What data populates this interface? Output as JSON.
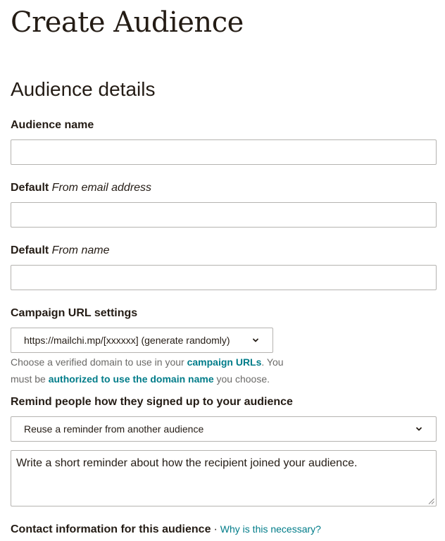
{
  "page": {
    "title": "Create Audience"
  },
  "section": {
    "title": "Audience details"
  },
  "fields": {
    "audience_name": {
      "label": "Audience name",
      "value": ""
    },
    "from_email": {
      "label_prefix": "Default ",
      "label_italic": "From email address",
      "value": ""
    },
    "from_name": {
      "label_prefix": "Default ",
      "label_italic": "From name",
      "value": ""
    }
  },
  "campaign_url": {
    "label": "Campaign URL settings",
    "selected": "https://mailchi.mp/[xxxxxx] (generate randomly)",
    "help_prefix": "Choose a verified domain to use in your ",
    "help_link1": "campaign URLs",
    "help_middle": ". You must be ",
    "help_link2": "authorized to use the domain name",
    "help_suffix": " you choose."
  },
  "reminder": {
    "label": "Remind people how they signed up to your audience",
    "select_value": "Reuse a reminder from another audience",
    "textarea_value": "Write a short reminder about how the recipient joined your audience."
  },
  "contact": {
    "label": "Contact information for this audience",
    "separator": "·",
    "link": "Why is this necessary?"
  },
  "colors": {
    "text": "#241c15",
    "link": "#007c89",
    "muted": "#6b6a68",
    "border": "#b5b3b0"
  },
  "icons": {
    "dropdown": "chevron-down-icon",
    "resize": "resize-grip-icon"
  }
}
